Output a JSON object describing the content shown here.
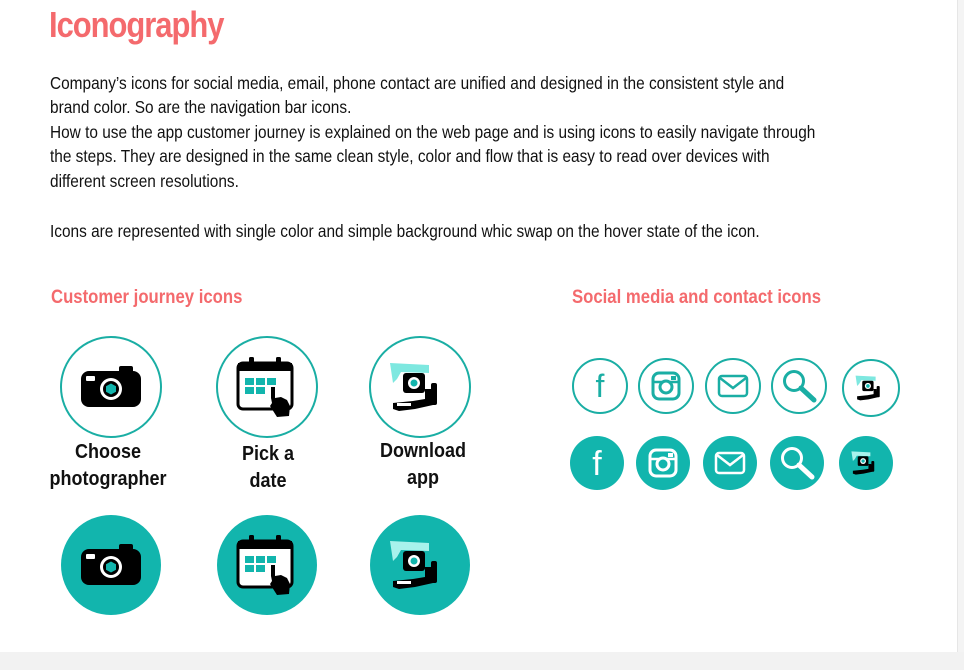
{
  "title": "Iconography",
  "paragraphs": [
    "Company’s icons for social media, email, phone contact are unified and designed in the consistent style and brand color. So are the navigation bar icons.",
    "How to use the app customer journey is explained on the web page and is using icons to easily navigate through the steps. They are designed in the same clean style, color and flow that is easy to read over devices with different screen resolutions.",
    "Icons are represented with single color and simple background whic swap on the hover state of the icon."
  ],
  "customer_journey": {
    "heading": "Customer journey icons",
    "items": [
      {
        "icon": "camera-icon",
        "label_lines": [
          "Choose",
          "photographer"
        ]
      },
      {
        "icon": "calendar-tap-icon",
        "label_lines": [
          "Pick a",
          "date"
        ]
      },
      {
        "icon": "download-app-icon",
        "label_lines": [
          "Download",
          "app"
        ]
      }
    ]
  },
  "social_contact": {
    "heading": "Social media and contact icons",
    "icons": [
      "facebook-icon",
      "instagram-icon",
      "email-icon",
      "search-icon",
      "download-app-icon"
    ],
    "facebook_glyph": "f"
  },
  "colors": {
    "accent_coral": "#f46a6d",
    "brand_teal": "#12b5ad",
    "text": "#111111"
  }
}
